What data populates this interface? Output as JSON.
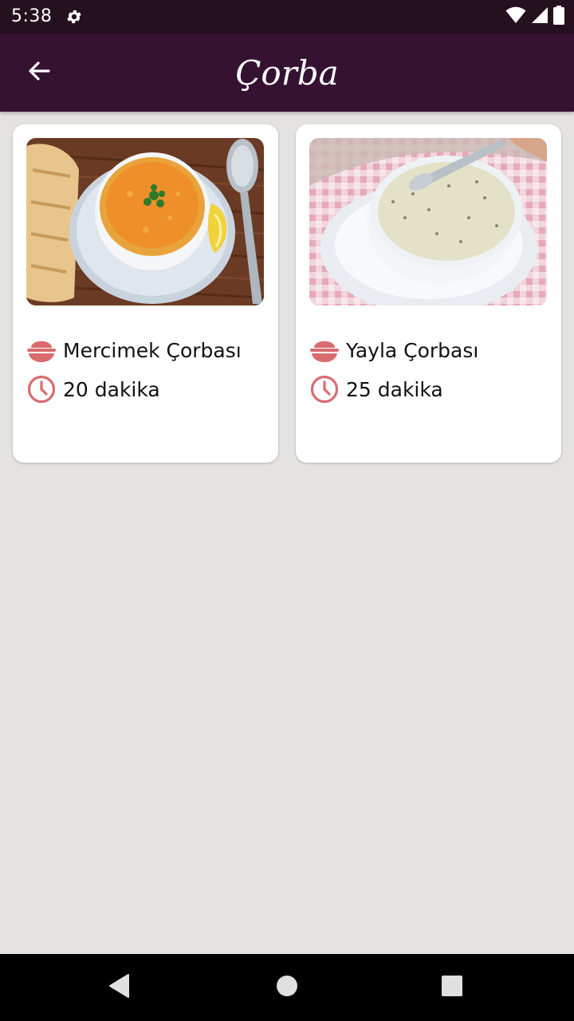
{
  "status_bar": {
    "time": "5:38",
    "icons": [
      "settings-gear-icon",
      "wifi-icon",
      "cell-signal-icon",
      "battery-icon"
    ]
  },
  "app_bar": {
    "title": "Çorba",
    "back_icon": "arrow-left-icon"
  },
  "recipes": [
    {
      "name": "Mercimek Çorbası",
      "duration": "20 dakika",
      "image": "red lentil soup in white bowl with lemon, bread and spoon",
      "name_icon": "bowl-icon",
      "time_icon": "clock-icon"
    },
    {
      "name": "Yayla Çorbası",
      "duration": "25 dakika",
      "image": "white yogurt soup with mint in white bowl on pink checkered cloth",
      "name_icon": "bowl-icon",
      "time_icon": "clock-icon"
    }
  ],
  "nav_bar": {
    "buttons": [
      "back-triangle-icon",
      "home-circle-icon",
      "recents-square-icon"
    ]
  },
  "colors": {
    "status_bar": "#25101e",
    "app_bar": "#361232",
    "background": "#e4e3e2",
    "accent_icon": "#d96b6f",
    "card": "#ffffff"
  }
}
